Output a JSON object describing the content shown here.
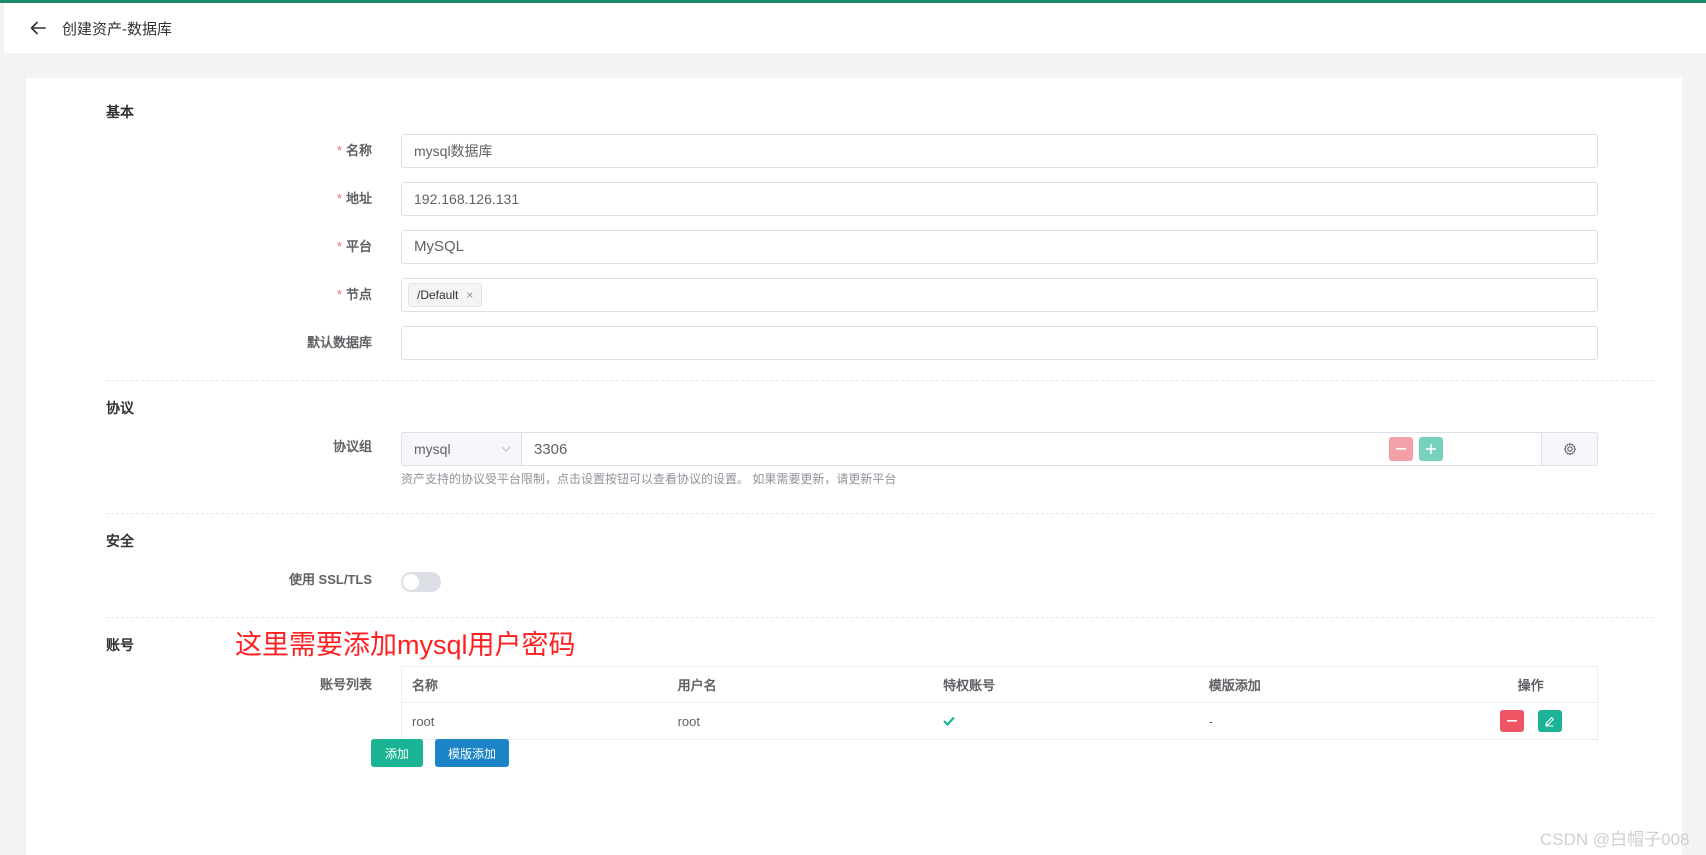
{
  "header": {
    "title": "创建资产-数据库"
  },
  "sections": {
    "basic": "基本",
    "protocol": "协议",
    "security": "安全",
    "account": "账号"
  },
  "basic": {
    "name": {
      "label": "名称",
      "value": "mysql数据库"
    },
    "address": {
      "label": "地址",
      "value": "192.168.126.131"
    },
    "platform": {
      "label": "平台",
      "value": "MySQL"
    },
    "node": {
      "label": "节点",
      "tag": "/Default",
      "tag_close": "×"
    },
    "default_db": {
      "label": "默认数据库",
      "value": ""
    }
  },
  "protocol": {
    "label": "协议组",
    "name": "mysql",
    "port": "3306",
    "help": "资产支持的协议受平台限制，点击设置按钮可以查看协议的设置。 如果需要更新，请更新平台"
  },
  "security": {
    "ssl_label": "使用 SSL/TLS",
    "ssl_enabled": false
  },
  "annotation": "这里需要添加mysql用户密码",
  "accounts": {
    "label": "账号列表",
    "columns": [
      "名称",
      "用户名",
      "特权账号",
      "模版添加",
      "操作"
    ],
    "rows": [
      {
        "name": "root",
        "username": "root",
        "privileged": true,
        "template": "-"
      }
    ],
    "add_button": "添加",
    "template_add_button": "模版添加"
  },
  "colors": {
    "accent": "#1ab394",
    "primary": "#1c84c6",
    "danger": "#ed5565",
    "required": "#f56c6c",
    "top_strip": "#1a8a6a"
  },
  "watermark": "CSDN @白帽子008"
}
